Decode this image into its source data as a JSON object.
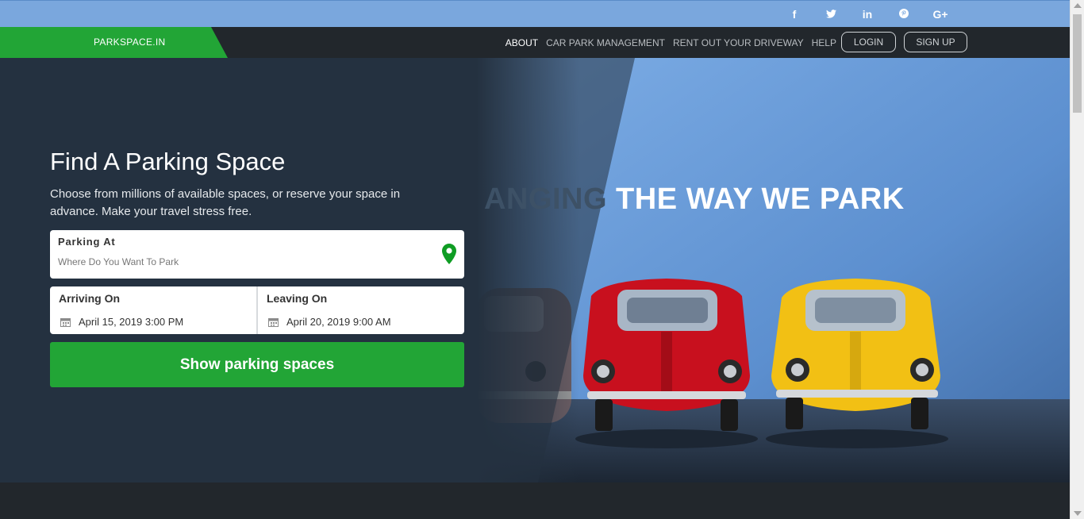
{
  "social": {
    "icons": [
      "facebook-icon",
      "twitter-icon",
      "linkedin-icon",
      "pinterest-icon",
      "google-plus-icon"
    ],
    "glyphs": [
      "f",
      "🐦",
      "in",
      "℗",
      "G+"
    ]
  },
  "nav": {
    "logo": "PARKSPACE.IN",
    "links": [
      "ABOUT",
      "CAR PARK MANAGEMENT",
      "RENT OUT YOUR DRIVEWAY",
      "HELP"
    ],
    "login": "LOGIN",
    "signup": "SIGN UP"
  },
  "hero": {
    "title": "Find A Parking Space",
    "subtitle": "Choose from millions of available spaces, or reserve your space in advance. Make your travel stress free.",
    "tagline_faded": "ANGING",
    "tagline": " THE WAY WE PARK",
    "parking": {
      "label": "Parking At",
      "placeholder": "Where Do You Want To Park"
    },
    "arriving": {
      "label": "Arriving On",
      "value": "April 15, 2019 3:00 PM"
    },
    "leaving": {
      "label": "Leaving On",
      "value": "April 20, 2019 9:00 AM"
    },
    "button": "Show parking spaces"
  },
  "colors": {
    "accent_green": "#22a536",
    "topbar_blue": "#7aa7dd",
    "navbar_dark": "#22272c",
    "hero_dark": "#243140"
  }
}
